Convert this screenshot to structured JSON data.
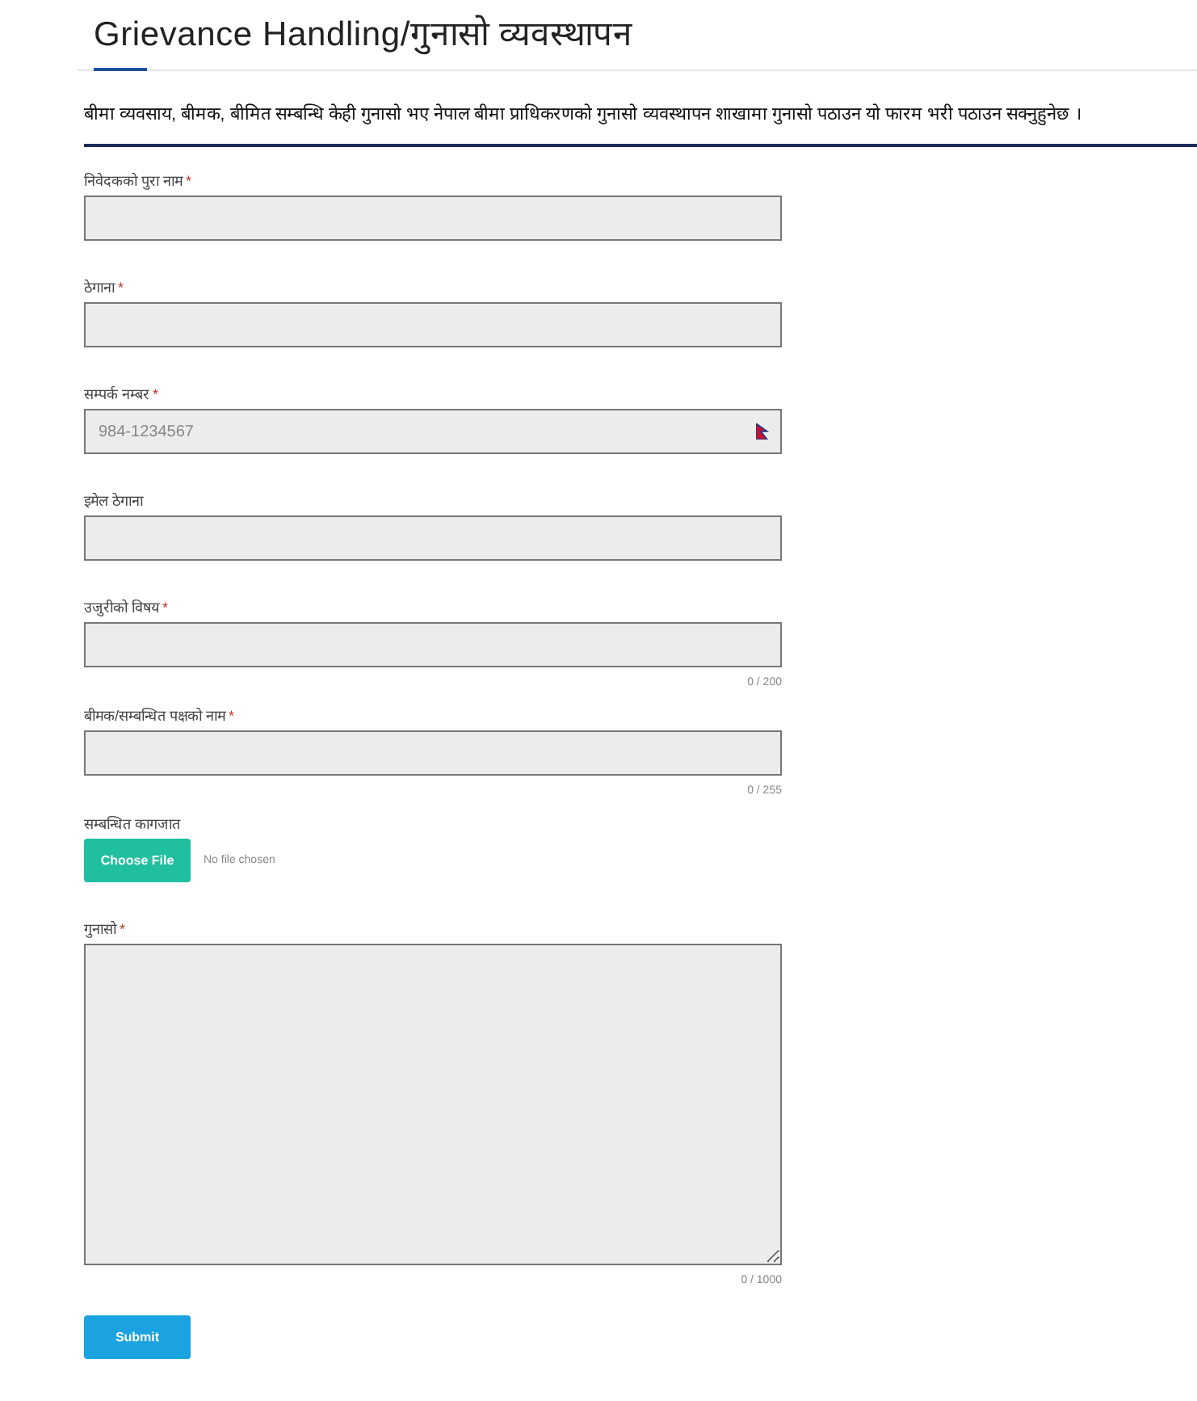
{
  "title": "Grievance Handling/गुनासो व्यवस्थापन",
  "intro": "बीमा व्यवसाय, बीमक, बीमित सम्बन्धि केही गुनासो भए नेपाल बीमा प्राधिकरणको गुनासो व्यवस्थापन शाखामा गुनासो पठाउन यो फारम भरी पठाउन सक्नुहुनेछ ।",
  "fields": [
    {
      "kind": "text",
      "label": "निवेदकको पुरा नाम",
      "mark": "*"
    },
    {
      "kind": "text",
      "label": "ठेगाना",
      "mark": "*"
    },
    {
      "kind": "phone",
      "label": "सम्पर्क नम्बर",
      "mark": "*",
      "placeholder": "984-1234567"
    },
    {
      "kind": "text",
      "label": "इमेल ठेगाना"
    },
    {
      "kind": "text",
      "label": "उजुरीको विषय",
      "mark": "*",
      "counter": "0 / 200"
    },
    {
      "kind": "text",
      "label": "बीमक/सम्बन्धित पक्षको नाम",
      "mark": "*",
      "counter": "0 / 255"
    },
    {
      "kind": "file",
      "label": "सम्बन्धित कागजात",
      "button": "Choose File",
      "status": "No file chosen"
    },
    {
      "kind": "textarea",
      "label": "गुनासो",
      "mark": "*",
      "counter": "0 / 1000"
    }
  ],
  "submit": "Submit"
}
